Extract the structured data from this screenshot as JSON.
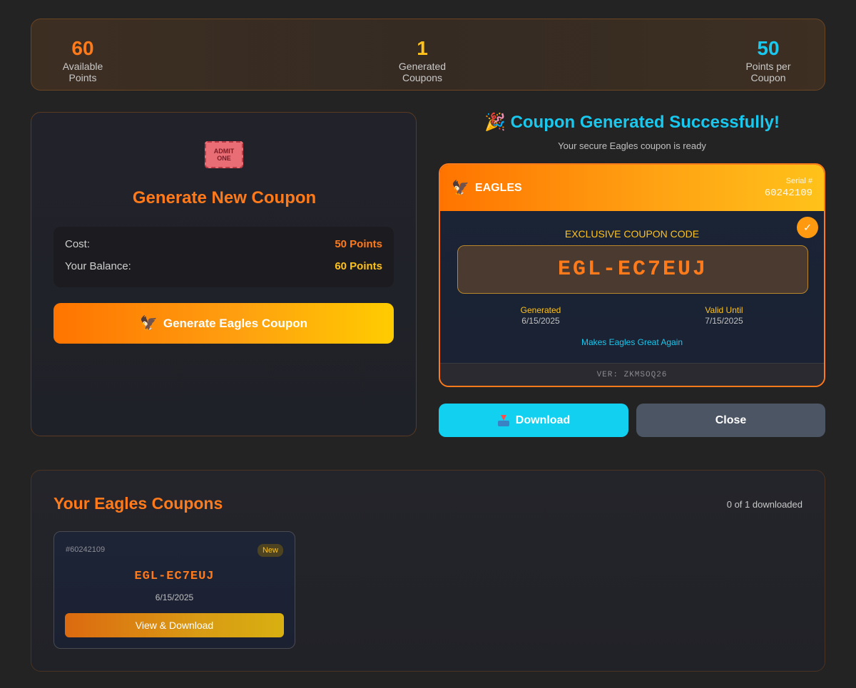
{
  "stats": {
    "available_points": "60",
    "available_label": "Available Points",
    "generated_coupons": "1",
    "generated_label": "Generated Coupons",
    "points_per_coupon": "50",
    "ppc_label": "Points per Coupon"
  },
  "generate": {
    "ticket_icon": "ticket-icon",
    "ticket_text": "ADMIT ONE",
    "title": "Generate New Coupon",
    "cost_label": "Cost:",
    "cost_value": "50 Points",
    "balance_label": "Your Balance:",
    "balance_value": "60 Points",
    "button_label": "Generate Eagles Coupon",
    "button_icon": "🦅"
  },
  "success": {
    "icon": "🎉",
    "title": "Coupon Generated Successfully!",
    "subtitle": "Your secure Eagles coupon is ready"
  },
  "coupon": {
    "brand": "EAGLES",
    "brand_icon": "🦅",
    "serial_label": "Serial #",
    "serial": "60242109",
    "check_icon": "✓",
    "exclusive_label": "EXCLUSIVE COUPON CODE",
    "code": "EGL-EC7EUJ",
    "generated_label": "Generated",
    "generated_date": "6/15/2025",
    "valid_label": "Valid Until",
    "valid_date": "7/15/2025",
    "tagline": "Makes Eagles Great Again",
    "version": "VER: ZKMSOQ26"
  },
  "actions": {
    "download_label": "Download",
    "close_label": "Close"
  },
  "list": {
    "title": "Your Eagles Coupons",
    "count": "0 of 1 downloaded",
    "items": [
      {
        "serial": "#60242109",
        "badge": "New",
        "code": "EGL-EC7EUJ",
        "date": "6/15/2025",
        "button": "View & Download"
      }
    ]
  },
  "colors": {
    "accent_orange": "#ff7a1a",
    "accent_yellow": "#ffc21a",
    "accent_cyan": "#19c8ee",
    "background": "#232323"
  }
}
